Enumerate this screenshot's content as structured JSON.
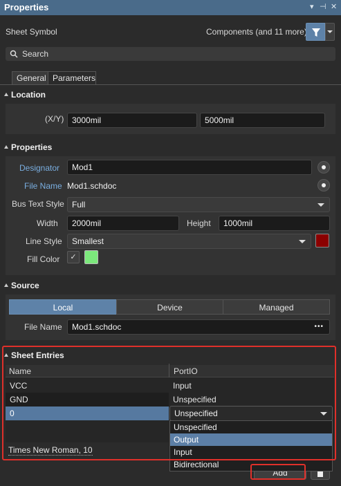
{
  "titlebar": {
    "title": "Properties",
    "controls": [
      "▾",
      "⊣",
      "✕"
    ]
  },
  "header": {
    "object_type": "Sheet Symbol",
    "filter_scope": "Components (and 11 more)"
  },
  "search": {
    "placeholder": "Search"
  },
  "tabs": [
    {
      "label": "General"
    },
    {
      "label": "Parameters"
    }
  ],
  "location": {
    "heading": "Location",
    "xy_label": "(X/Y)",
    "x_value": "3000mil",
    "y_value": "5000mil"
  },
  "properties": {
    "heading": "Properties",
    "designator_label": "Designator",
    "designator_value": "Mod1",
    "filename_label": "File Name",
    "filename_value": "Mod1.schdoc",
    "bus_text_style_label": "Bus Text Style",
    "bus_text_style_value": "Full",
    "width_label": "Width",
    "width_value": "2000mil",
    "height_label": "Height",
    "height_value": "1000mil",
    "line_style_label": "Line Style",
    "line_style_value": "Smallest",
    "line_color": "#8b0000",
    "fill_color_label": "Fill Color",
    "fill_checked": "✓",
    "fill_color": "#7ce87c"
  },
  "source": {
    "heading": "Source",
    "options": [
      {
        "label": "Local"
      },
      {
        "label": "Device"
      },
      {
        "label": "Managed"
      }
    ],
    "active_option": "Local",
    "filename_label": "File Name",
    "filename_value": "Mod1.schdoc",
    "more_label": "•••"
  },
  "sheet_entries": {
    "heading": "Sheet Entries",
    "columns": {
      "name": "Name",
      "portio": "PortIO"
    },
    "rows": [
      {
        "name": "VCC",
        "io": "Input"
      },
      {
        "name": "GND",
        "io": "Unspecified"
      },
      {
        "name": "0",
        "io": "Unspecified"
      }
    ],
    "dropdown_options": [
      "Unspecified",
      "Output",
      "Input",
      "Bidirectional"
    ],
    "dropdown_selected": "Output",
    "font_label": "Times New Roman, 10",
    "add_label": "Add",
    "delete_icon": "trash-icon"
  },
  "colors": {
    "accent": "#5679a0",
    "highlight_red": "#e0302a",
    "label_blue": "#7aaee0"
  }
}
